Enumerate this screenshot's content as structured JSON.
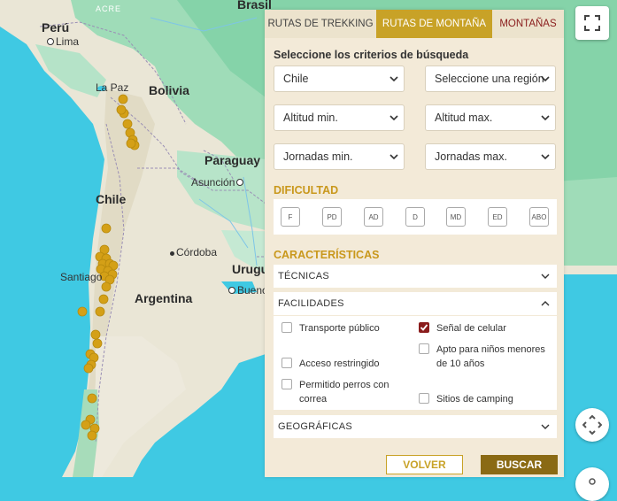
{
  "map": {
    "countries": [
      "Brasil",
      "Perú",
      "Bolivia",
      "Paraguay",
      "Chile",
      "Argentina",
      "Uruguay"
    ],
    "cities": [
      "Lima",
      "La Paz",
      "Asunción",
      "Córdoba",
      "Santiago",
      "Buenos"
    ],
    "ocean": "ACRE",
    "marker_color": "#d4a017"
  },
  "panel": {
    "tabs": [
      {
        "label": "RUTAS DE TREKKING",
        "active": false
      },
      {
        "label": "RUTAS DE MONTAÑA",
        "active": true
      },
      {
        "label": "MONTAÑAS",
        "active": false
      }
    ],
    "criteria_title": "Seleccione los criterios de búsqueda",
    "selects": {
      "country": "Chile",
      "region": "Seleccione una región",
      "alt_min": "Altitud min.",
      "alt_max": "Altitud max.",
      "days_min": "Jornadas min.",
      "days_max": "Jornadas max."
    },
    "difficulty_title": "DIFICULTAD",
    "difficulties": [
      "F",
      "PD",
      "AD",
      "D",
      "MD",
      "ED",
      "ABO"
    ],
    "features_title": "CARACTERÍSTICAS",
    "tecnicas": "TÉCNICAS",
    "facilidades": "FACILIDADES",
    "geograficas": "GEOGRÁFICAS",
    "facilities": [
      {
        "label": "Transporte público",
        "checked": false
      },
      {
        "label": "Señal de celular",
        "checked": true
      },
      {
        "label": "Acceso restringido",
        "checked": false
      },
      {
        "label": "Apto para niños menores de 10 años",
        "checked": false
      },
      {
        "label": "Permitido perros con correa",
        "checked": false
      },
      {
        "label": "Sitios de camping",
        "checked": false
      }
    ],
    "back_label": "VOLVER",
    "search_label": "BUSCAR",
    "accent_gold": "#c8a227",
    "accent_red": "#8a1c1c"
  }
}
